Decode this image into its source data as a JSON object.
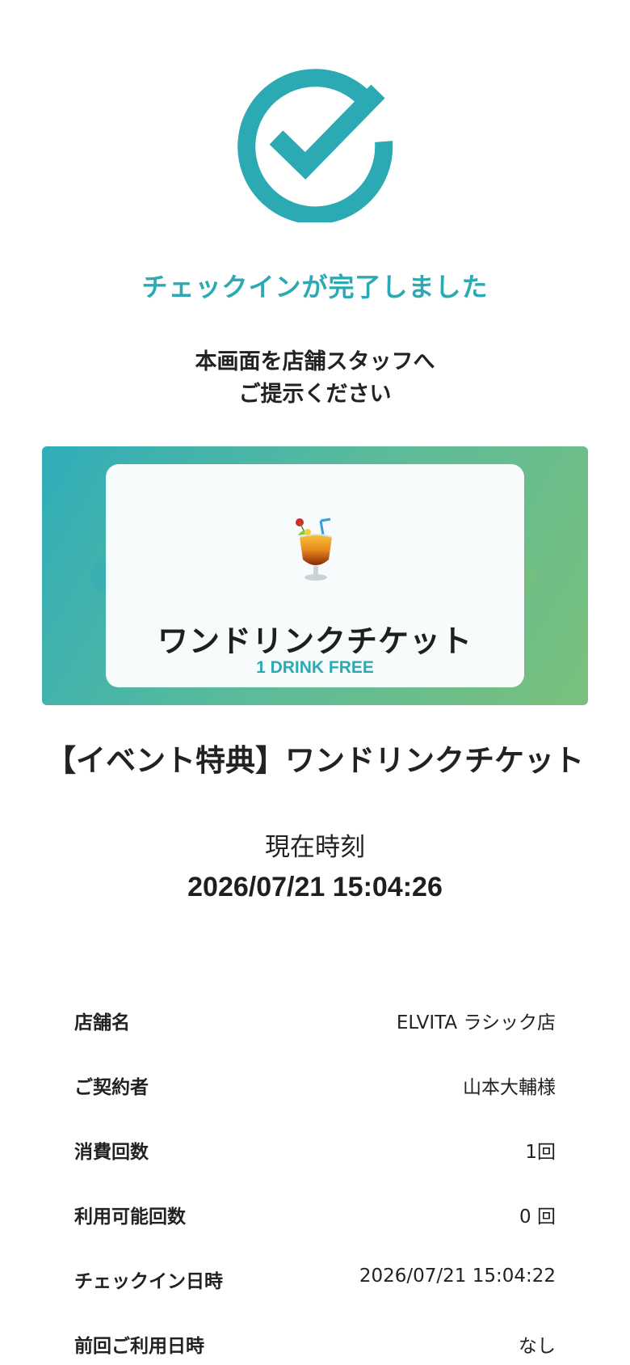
{
  "status": {
    "icon": "check-circle-icon",
    "title": "チェックインが完了しました"
  },
  "instruction": {
    "line1": "本画面を店舗スタッフへ",
    "line2": "ご提示ください"
  },
  "ticket": {
    "icon": "tropical-drink-icon",
    "name": "ワンドリンクチケット",
    "subtitle": "1 DRINK FREE",
    "full_title": "【イベント特典】ワンドリンクチケット"
  },
  "current_time": {
    "label": "現在時刻",
    "value": "2026/07/21 15:04:26"
  },
  "details": [
    {
      "label": "店舗名",
      "value": "ELVITA ラシック店"
    },
    {
      "label": "ご契約者",
      "value": "山本大輔様"
    },
    {
      "label": "消費回数",
      "value": "1回"
    },
    {
      "label": "利用可能回数",
      "value": "0 回"
    },
    {
      "label": "チェックイン日時",
      "value": "2026/07/21 15:04:22"
    },
    {
      "label": "前回ご利用日時",
      "value": "なし"
    }
  ],
  "colors": {
    "accent": "#2baab4",
    "gradient_start": "#30adb9",
    "gradient_end": "#7ac07c",
    "text": "#222222"
  }
}
